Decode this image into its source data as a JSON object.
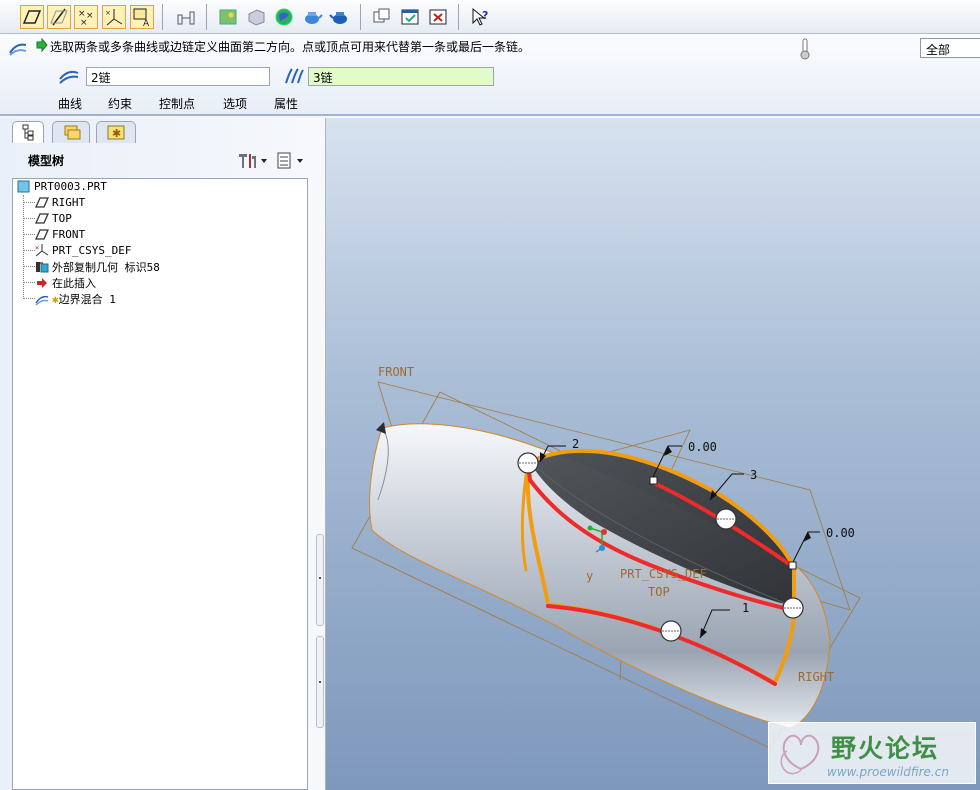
{
  "toolbar": {
    "icons": [
      "datum-plane-icon",
      "datum-axis-icon",
      "datum-point-icon",
      "datum-csys-icon",
      "datum-annotation-icon",
      "dimension-icon",
      "shade-icon",
      "wireframe-icon",
      "globe-icon",
      "teapot-icon",
      "teapot-blue-icon",
      "window-icon",
      "activate-window-icon",
      "close-window-icon",
      "context-help-icon"
    ]
  },
  "dashboard": {
    "message": "选取两条或多条曲线或边链定义曲面第二方向。点或顶点可用来代替第一条或最后一条链。",
    "scope": "全部",
    "first_direction_chain": "2链",
    "second_direction_chain": "3链",
    "tabs": [
      "曲线",
      "约束",
      "控制点",
      "选项",
      "属性"
    ]
  },
  "model_tree": {
    "title": "模型树",
    "root": "PRT0003.PRT",
    "items": [
      "RIGHT",
      "TOP",
      "FRONT",
      "PRT_CSYS_DEF",
      "外部复制几何 标识58",
      "在此插入",
      "边界混合 1"
    ]
  },
  "viewport": {
    "labels": {
      "front": "FRONT",
      "right": "RIGHT",
      "top": "TOP",
      "csys": "PRT_CSYS_DEF",
      "csys_prefix": "y",
      "dim_top": "0.00",
      "dim_right": "0.00",
      "chain_1": "1",
      "chain_2": "2",
      "chain_3": "3"
    },
    "colors": {
      "chain_red": "#ee2a2a",
      "chain_orange": "#f29c12",
      "background_top": "#d7e2ef",
      "background_bottom": "#7e98bc"
    }
  },
  "watermark": {
    "title": "野火论坛",
    "url": "www.proewildfire.cn"
  }
}
